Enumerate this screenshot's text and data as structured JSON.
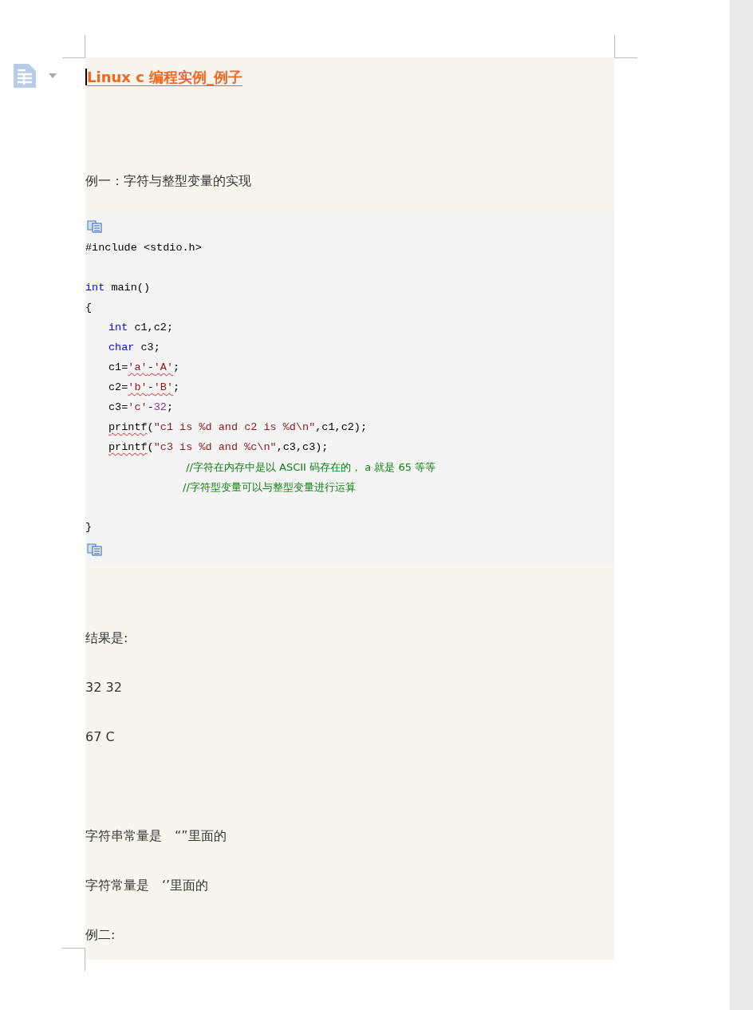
{
  "title": "Linux c 编程实例_例子",
  "blocks": [
    {
      "kind": "empty"
    },
    {
      "kind": "paragraph",
      "text": "例一：字符与整型变量的实现"
    },
    {
      "kind": "code",
      "lines": [
        {
          "kind": "flush",
          "tokens": [
            {
              "kind": "plain",
              "text": "#include <stdio.h>"
            }
          ]
        },
        {
          "kind": "blank"
        },
        {
          "kind": "flush",
          "tokens": [
            {
              "kind": "keyword",
              "text": "int"
            },
            {
              "kind": "plain",
              "text": " main()"
            }
          ]
        },
        {
          "kind": "flush",
          "tokens": [
            {
              "kind": "plain",
              "text": "{"
            }
          ]
        },
        {
          "kind": "indented",
          "tokens": [
            {
              "kind": "keyword",
              "text": "int"
            },
            {
              "kind": "plain",
              "text": " c1,c2;"
            }
          ]
        },
        {
          "kind": "indented",
          "tokens": [
            {
              "kind": "keyword",
              "text": "char"
            },
            {
              "kind": "plain",
              "text": " c3;"
            }
          ]
        },
        {
          "kind": "indented",
          "tokens": [
            {
              "kind": "plain",
              "text": "c1="
            },
            {
              "kind": "string",
              "text": "'a'",
              "misspelled": true
            },
            {
              "kind": "plain",
              "text": "-",
              "misspelled": true
            },
            {
              "kind": "string",
              "text": "'A'",
              "misspelled": true
            },
            {
              "kind": "plain",
              "text": ";"
            }
          ]
        },
        {
          "kind": "indented",
          "tokens": [
            {
              "kind": "plain",
              "text": "c2="
            },
            {
              "kind": "string",
              "text": "'b'",
              "misspelled": true
            },
            {
              "kind": "plain",
              "text": "-",
              "misspelled": true
            },
            {
              "kind": "string",
              "text": "'B'",
              "misspelled": true
            },
            {
              "kind": "plain",
              "text": ";"
            }
          ]
        },
        {
          "kind": "indented",
          "tokens": [
            {
              "kind": "plain",
              "text": "c3="
            },
            {
              "kind": "string",
              "text": "'c'"
            },
            {
              "kind": "plain",
              "text": "-"
            },
            {
              "kind": "number",
              "text": "32"
            },
            {
              "kind": "plain",
              "text": ";"
            }
          ]
        },
        {
          "kind": "indented",
          "tokens": [
            {
              "kind": "plain",
              "text": "printf",
              "misspelled": true
            },
            {
              "kind": "plain",
              "text": "("
            },
            {
              "kind": "string",
              "text": "\"c1 is %d and c2 is %d\\n\""
            },
            {
              "kind": "plain",
              "text": ",c1,c2);"
            }
          ]
        },
        {
          "kind": "indented",
          "tokens": [
            {
              "kind": "plain",
              "text": "printf",
              "misspelled": true
            },
            {
              "kind": "plain",
              "text": "("
            },
            {
              "kind": "string",
              "text": "\"c3 is %d and %c\\n\""
            },
            {
              "kind": "plain",
              "text": ",c3,c3);"
            }
          ]
        },
        {
          "kind": "note",
          "tokens": [
            {
              "kind": "comment",
              "text": " //字符在内存中是以 ASCII 码存在的， a 就是 65 等等"
            }
          ]
        },
        {
          "kind": "note",
          "tokens": [
            {
              "kind": "comment",
              "text": "//字符型变量可以与整型变量进行运算"
            }
          ]
        },
        {
          "kind": "blank"
        },
        {
          "kind": "flush",
          "tokens": [
            {
              "kind": "plain",
              "text": "}"
            }
          ]
        }
      ]
    },
    {
      "kind": "empty"
    },
    {
      "kind": "paragraph",
      "text": "结果是:"
    },
    {
      "kind": "paragraph",
      "text": "32 32"
    },
    {
      "kind": "paragraph",
      "text": "67 C"
    },
    {
      "kind": "empty"
    },
    {
      "kind": "paragraph",
      "text": "字符串常量是　“”里面的"
    },
    {
      "kind": "paragraph",
      "text": "字符常量是　‘’里面的"
    },
    {
      "kind": "paragraph",
      "text": "例二:"
    }
  ]
}
